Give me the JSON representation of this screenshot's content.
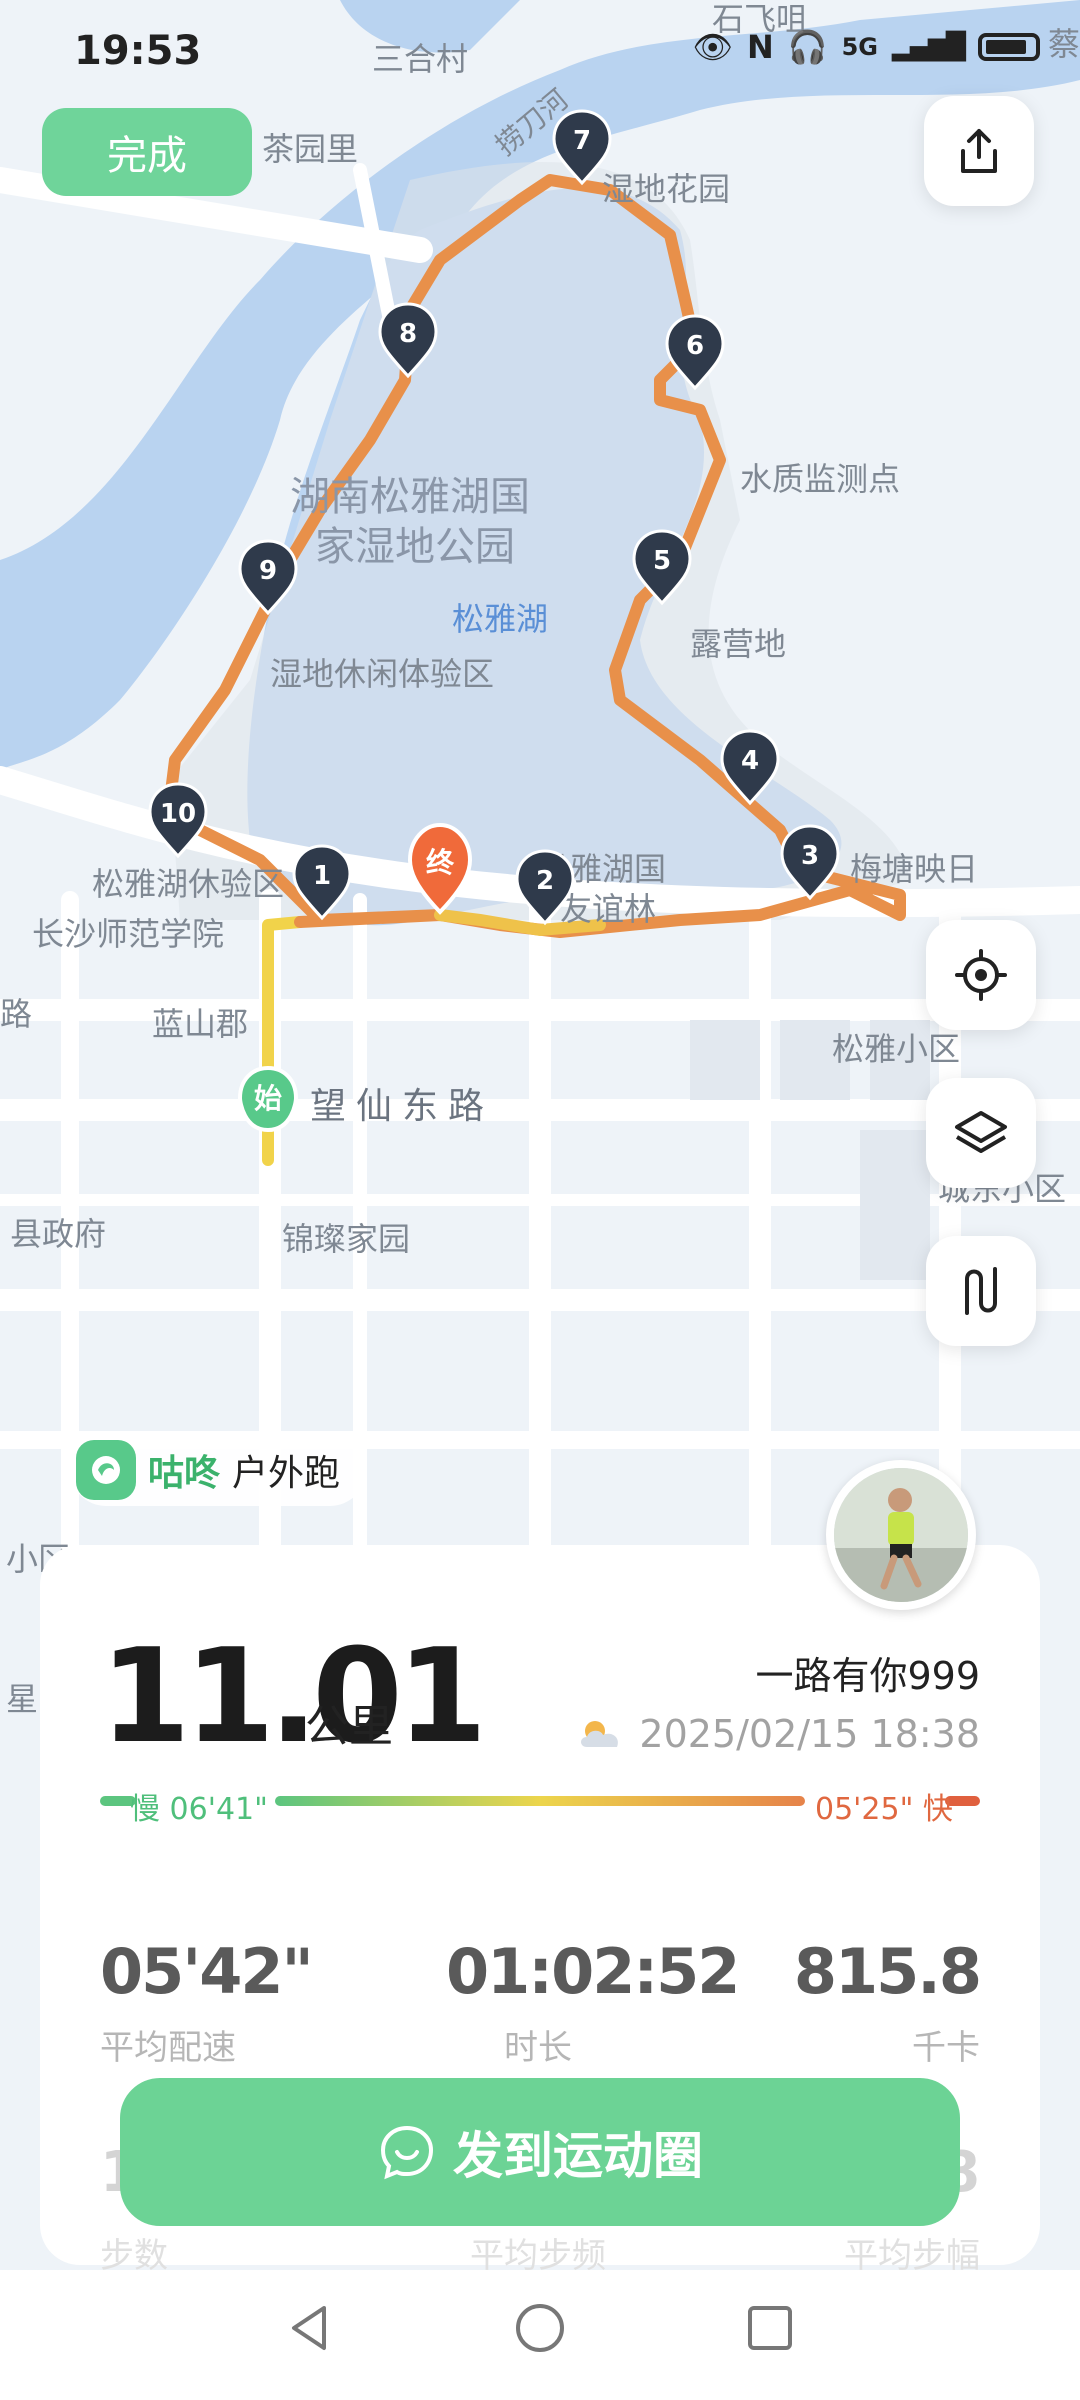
{
  "status": {
    "time": "19:53",
    "network": "5G"
  },
  "header": {
    "done_label": "完成"
  },
  "map": {
    "labels": {
      "l1": "石飞咀",
      "l2": "三合村",
      "l3": "茶园里",
      "l4": "捞刀河",
      "l5": "湿地花园",
      "l6": "湖南松雅湖国",
      "l7": "家湿地公园",
      "l8": "松雅湖",
      "l9": "湿地休闲体验区",
      "l10": "水质监测点",
      "l11": "露营地",
      "l12": "松雅湖休验区",
      "l13": "长沙师范学院",
      "l14": "松雅湖国",
      "l15": "友谊林",
      "l16": "梅塘映日",
      "l17": "蓝山郡",
      "l18": "望仙东路",
      "l19": "松雅小区",
      "l20": "城东小区",
      "l21": "县政府",
      "l22": "锦璨家园",
      "l23": "路",
      "l24": "小区",
      "l25": "星",
      "l26": "蔡"
    },
    "start_marker": "始",
    "end_marker": "终",
    "km_markers": [
      "1",
      "2",
      "3",
      "4",
      "5",
      "6",
      "7",
      "8",
      "9",
      "10"
    ]
  },
  "app_chip": {
    "app_name": "咕咚",
    "activity": "户外跑"
  },
  "summary": {
    "distance": "11.01",
    "distance_unit": "公里",
    "username": "一路有你999",
    "datetime": "2025/02/15 18:38",
    "pace_slow": "慢 06'41\"",
    "pace_fast": "05'25\" 快"
  },
  "stats": [
    {
      "value": "05'42\"",
      "label": "平均配速"
    },
    {
      "value": "01:02:52",
      "label": "时长"
    },
    {
      "value": "815.8",
      "label": "千卡"
    }
  ],
  "stats_row2": [
    {
      "value": "1",
      "label": "步数"
    },
    {
      "value": "",
      "label": "平均步频"
    },
    {
      "value": "8",
      "label": "平均步幅"
    }
  ],
  "share_button": {
    "label": "发到运动圈"
  },
  "colors": {
    "accent_green": "#6cd395",
    "route_orange": "#e8904a",
    "route_yellow": "#f1d34a",
    "lake_blue": "#bcd6f3",
    "marker_dark": "#2f3a4b",
    "end_marker": "#f06a3a"
  }
}
